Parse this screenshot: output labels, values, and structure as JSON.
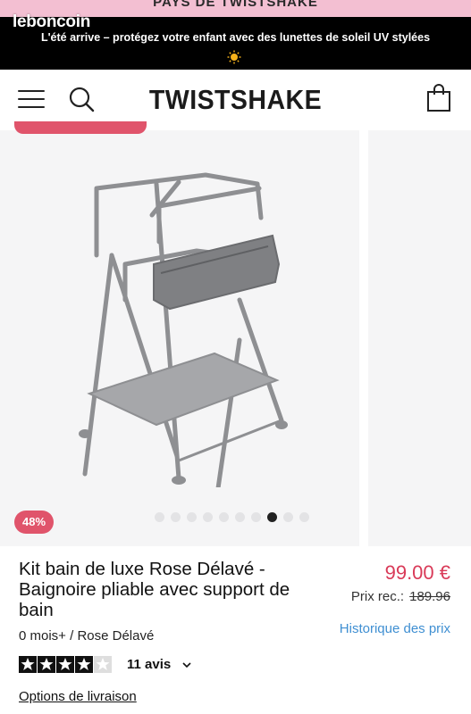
{
  "top_banner": {
    "text": "PAYS DE TWISTSHAKE"
  },
  "promo": {
    "text": "L'été arrive – protégez votre enfant avec des lunettes de soleil UV stylées"
  },
  "watermark": "leboncoin",
  "header": {
    "logo": "TWISTSHAKE",
    "icons": [
      "menu-icon",
      "search-icon",
      "bag-icon"
    ]
  },
  "gallery": {
    "discount_badge": "48%",
    "dot_count": 10,
    "active_dot": 7
  },
  "product": {
    "title": "Kit bain de luxe Rose Délavé - Baignoire pliable avec support de bain",
    "price": "99.00 €",
    "recommended_label": "Prix rec.:",
    "recommended_price": "189.96",
    "variant": "0 mois+ / Rose Délavé",
    "price_history": "Historique des prix",
    "rating": 4,
    "rating_max": 5,
    "reviews": "11 avis",
    "shipping_options": "Options de livraison"
  },
  "colors": {
    "accent": "#e0546b",
    "price": "#d93a58",
    "link": "#3f8fd2",
    "promo_bg": "#000000",
    "top_banner_bg": "#f3bfd2"
  }
}
